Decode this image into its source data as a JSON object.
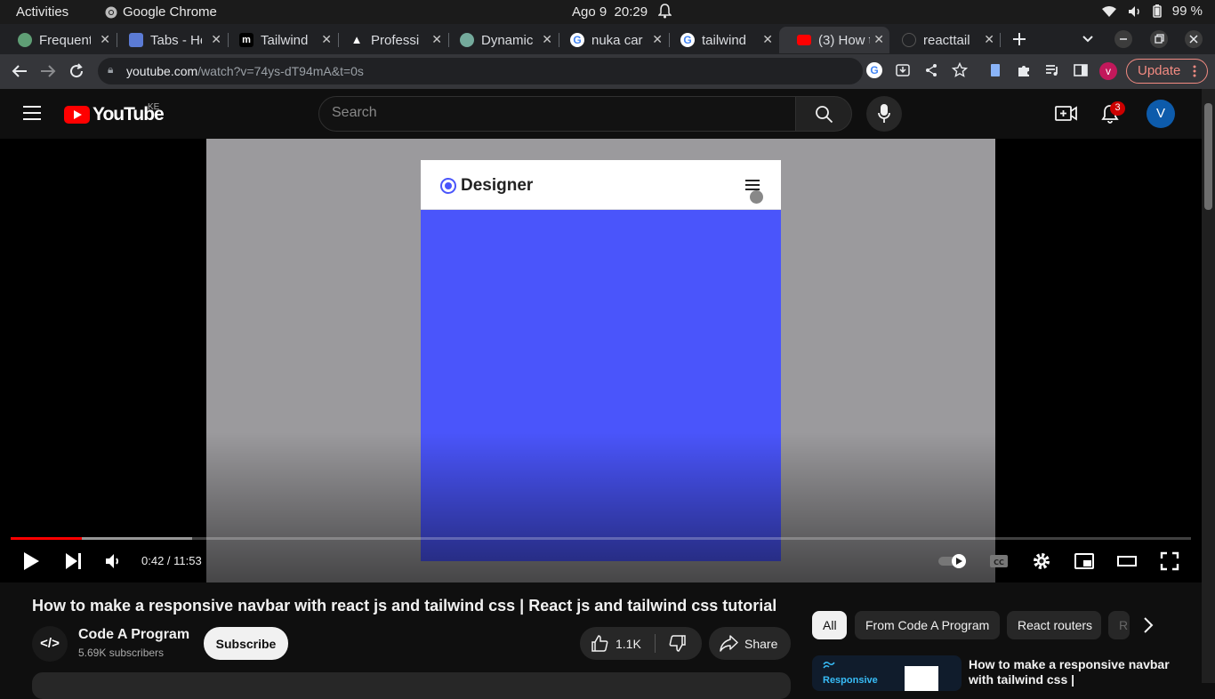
{
  "system": {
    "activities": "Activities",
    "app_name": "Google Chrome",
    "date": "Ago 9",
    "time": "20:29",
    "battery": "99 %"
  },
  "tabs": [
    {
      "title": "Frequent",
      "color": "#5f9e75"
    },
    {
      "title": "Tabs - He",
      "color": "#5b7bd5"
    },
    {
      "title": "Tailwind",
      "color": "#000000"
    },
    {
      "title": "Professi",
      "color": "#000000"
    },
    {
      "title": "Dynamic",
      "color": "#74aa9c"
    },
    {
      "title": "nuka car",
      "color": "#ffffff"
    },
    {
      "title": "tailwind",
      "color": "#ffffff"
    },
    {
      "title": "(3) How t",
      "color": "#ff0000"
    },
    {
      "title": "reacttail",
      "color": "#555555"
    }
  ],
  "toolbar": {
    "url_host": "youtube.com",
    "url_path": "/watch?v=74ys-dT94mA&t=0s",
    "profile_initial": "v",
    "update_label": "Update"
  },
  "youtube": {
    "logo_text": "YouTube",
    "country": "KE",
    "search_placeholder": "Search",
    "notif_count": "3",
    "avatar_initial": "V"
  },
  "video": {
    "mock_brand": "Designer",
    "current_time": "0:42",
    "duration": "11:53",
    "time_display": "0:42 / 11:53",
    "played_fraction": 0.06,
    "loaded_fraction": 0.154,
    "title": "How to make a responsive navbar with react js and tailwind css | React js and tailwind css tutorial",
    "channel": "Code A Program",
    "channel_icon": "</>",
    "subscribers": "5.69K subscribers",
    "subscribe_label": "Subscribe",
    "likes": "1.1K",
    "share_label": "Share"
  },
  "chips": [
    "All",
    "From Code A Program",
    "React routers",
    "R"
  ],
  "recommendation": {
    "thumb_label": "Responsive",
    "title": "How to make a responsive navbar with tailwind css |"
  },
  "colors": {
    "brand_red": "#ff0000",
    "mock_blue": "#4a55fb",
    "update_red": "#f28b82"
  }
}
